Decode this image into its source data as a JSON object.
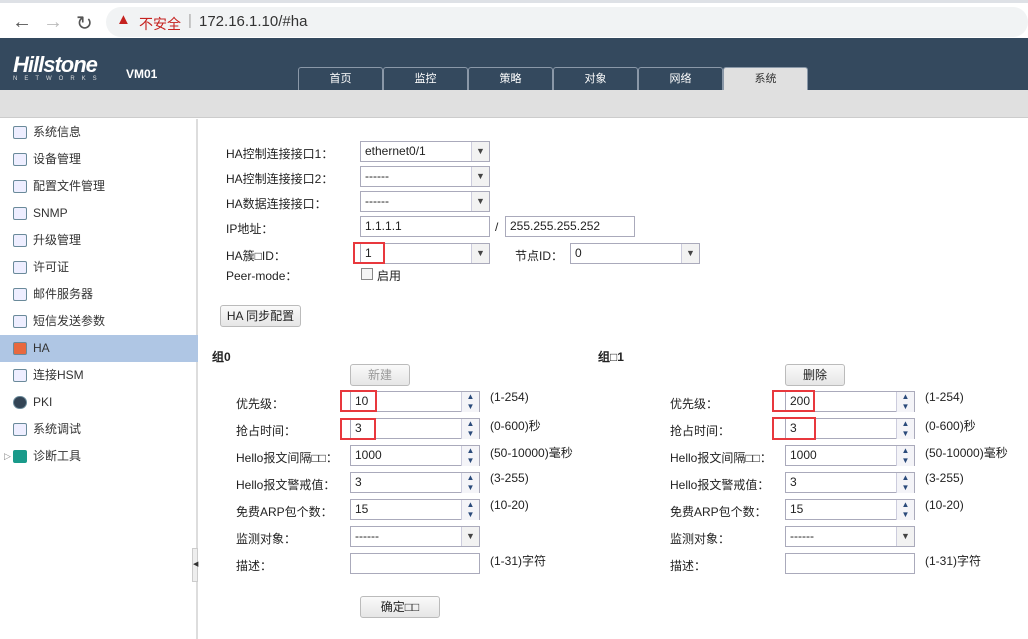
{
  "browser": {
    "back": "←",
    "forward": "→",
    "reload": "↻",
    "security": "不安全",
    "url": "172.16.1.10/#ha"
  },
  "header": {
    "logo": "Hillstone",
    "logo_sub": "NETWORKS",
    "device": "VM01",
    "tabs": [
      "首页",
      "监控",
      "策略",
      "对象",
      "网络",
      "系统"
    ],
    "active_tab": "系统"
  },
  "sidebar": {
    "items": [
      "系统信息",
      "设备管理",
      "配置文件管理",
      "SNMP",
      "升级管理",
      "许可证",
      "邮件服务器",
      "短信发送参数",
      "HA",
      "连接HSM",
      "PKI",
      "系统调试",
      "诊断工具"
    ],
    "active": "HA"
  },
  "form": {
    "ctrl1_label": "HA控制连接接口1：",
    "ctrl1_value": "ethernet0/1",
    "ctrl2_label": "HA控制连接接口2：",
    "ctrl2_value": "------",
    "data_label": "HA数据连接接口：",
    "data_value": "------",
    "ip_label": "IP地址：",
    "ip_value": "1.1.1.1",
    "slash": "/",
    "mask_value": "255.255.255.252",
    "cluster_label": "HA簇□ID：",
    "cluster_value": "1",
    "node_label": "节点ID：",
    "node_value": "0",
    "peer_label": "Peer-mode：",
    "peer_checkbox": "启用",
    "peer_checked": false,
    "sync_button": "HA 同步配置"
  },
  "groups": [
    {
      "title": "组0",
      "button": "新建",
      "button_disabled": true,
      "priority": "10",
      "preempt": "3",
      "hello_interval": "1000",
      "hello_threshold": "3",
      "arp_count": "15",
      "monitor": "------",
      "description": ""
    },
    {
      "title": "组□1",
      "button": "删除",
      "button_disabled": false,
      "priority": "200",
      "preempt": "3",
      "hello_interval": "1000",
      "hello_threshold": "3",
      "arp_count": "15",
      "monitor": "------",
      "description": ""
    }
  ],
  "group_labels": {
    "priority": "优先级：",
    "preempt": "抢占时间：",
    "hello_interval": "Hello报文间隔□□：",
    "hello_threshold": "Hello报文警戒值：",
    "arp_count": "免费ARP包个数：",
    "monitor": "监测对象：",
    "description": "描述："
  },
  "group_hints": {
    "priority": "(1-254)",
    "preempt": "(0-600)秒",
    "hello_interval": "(50-10000)毫秒",
    "hello_threshold": "(3-255)",
    "arp_count": "(10-20)",
    "description": "(1-31)字符"
  },
  "confirm_button": "确定□□",
  "colors": {
    "header": "#34495e",
    "active_sidebar": "#afc6e4",
    "highlight": "#e8383d"
  }
}
